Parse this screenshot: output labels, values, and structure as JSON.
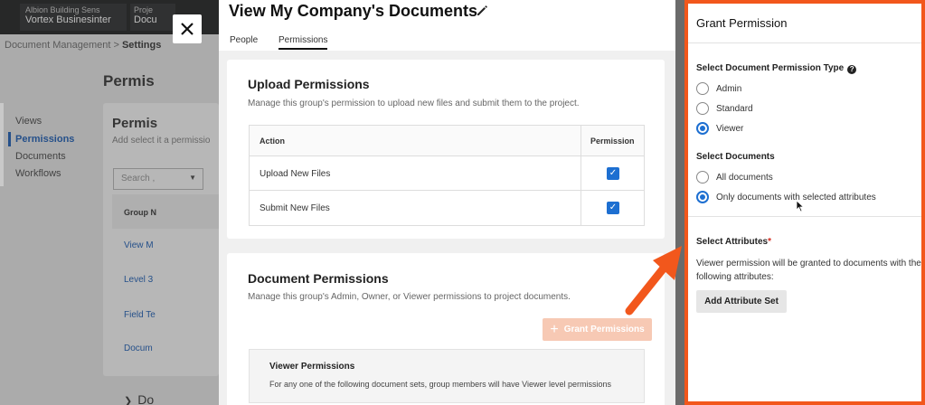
{
  "background": {
    "header": {
      "project1_line1": "Albion Building Sens",
      "project1_line2": "Vortex Businesinter",
      "project2_line1": "Proje",
      "project2_line2": "Docu"
    },
    "breadcrumb": {
      "item1": "Document Management",
      "sep": ">",
      "item2": "Settings"
    },
    "page_title": "Permis",
    "sidebar": {
      "items": [
        "Views",
        "Permissions",
        "Documents",
        "Workflows"
      ]
    },
    "card": {
      "title": "Permis",
      "subtitle": "Add select it a permissio",
      "search_placeholder": "Search ,",
      "table_header": "Group N",
      "rows": [
        "View M",
        "Level 3",
        "Field Te",
        "Docum"
      ]
    },
    "footer_label": "Do"
  },
  "modal": {
    "title": "View My Company's Documents",
    "tabs": [
      "People",
      "Permissions"
    ],
    "upload": {
      "title": "Upload Permissions",
      "subtitle": "Manage this group's permission to upload new files and submit them to the project.",
      "col_action": "Action",
      "col_permission": "Permission",
      "rows": [
        {
          "action": "Upload New Files",
          "checked": true
        },
        {
          "action": "Submit New Files",
          "checked": true
        }
      ]
    },
    "documents": {
      "title": "Document Permissions",
      "subtitle": "Manage this group's Admin, Owner, or Viewer permissions to project documents.",
      "grant_button": "Grant Permissions",
      "viewer": {
        "title": "Viewer Permissions",
        "subtitle": "For any one of the following document sets, group members will have Viewer level permissions"
      }
    }
  },
  "grant_panel": {
    "title": "Grant Permission",
    "type_label": "Select Document Permission Type",
    "types": [
      {
        "label": "Admin",
        "checked": false
      },
      {
        "label": "Standard",
        "checked": false
      },
      {
        "label": "Viewer",
        "checked": true
      }
    ],
    "documents_label": "Select Documents",
    "documents": [
      {
        "label": "All documents",
        "checked": false
      },
      {
        "label": "Only documents with selected attributes",
        "checked": true
      }
    ],
    "attributes_label": "Select Attributes",
    "required_mark": "*",
    "attributes_text": "Viewer permission will be granted to documents with the following attributes:",
    "add_button": "Add Attribute Set"
  },
  "colors": {
    "accent_blue": "#1d6fd1",
    "highlight_orange": "#f2571c",
    "grant_button_disabled": "#f7c9b4"
  },
  "icons": [
    "close-icon",
    "pencil-icon",
    "check-icon",
    "plus-icon",
    "help-icon",
    "mouse-cursor-icon",
    "callout-arrow-icon",
    "chevron-down-icon",
    "chevron-right-icon"
  ]
}
